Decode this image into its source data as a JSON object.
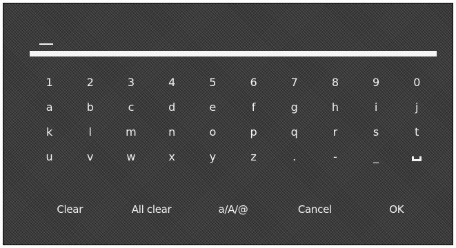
{
  "input": {
    "value": "",
    "cursor_icon": "text-cursor-underscore"
  },
  "keyboard": {
    "rows": [
      [
        "1",
        "2",
        "3",
        "4",
        "5",
        "6",
        "7",
        "8",
        "9",
        "0"
      ],
      [
        "a",
        "b",
        "c",
        "d",
        "e",
        "f",
        "g",
        "h",
        "i",
        "j"
      ],
      [
        "k",
        "l",
        "m",
        "n",
        "o",
        "p",
        "q",
        "r",
        "s",
        "t"
      ],
      [
        "u",
        "v",
        "w",
        "x",
        "y",
        "z",
        ".",
        "-",
        "_",
        ""
      ]
    ],
    "space_key_icon": "space-bar-icon"
  },
  "actions": {
    "clear": "Clear",
    "all_clear": "All clear",
    "mode": "a/A/@",
    "cancel": "Cancel",
    "ok": "OK"
  },
  "colors": {
    "background": "#3a3a3a",
    "text": "#f2f2f2",
    "input_line": "#f5f5f5"
  }
}
